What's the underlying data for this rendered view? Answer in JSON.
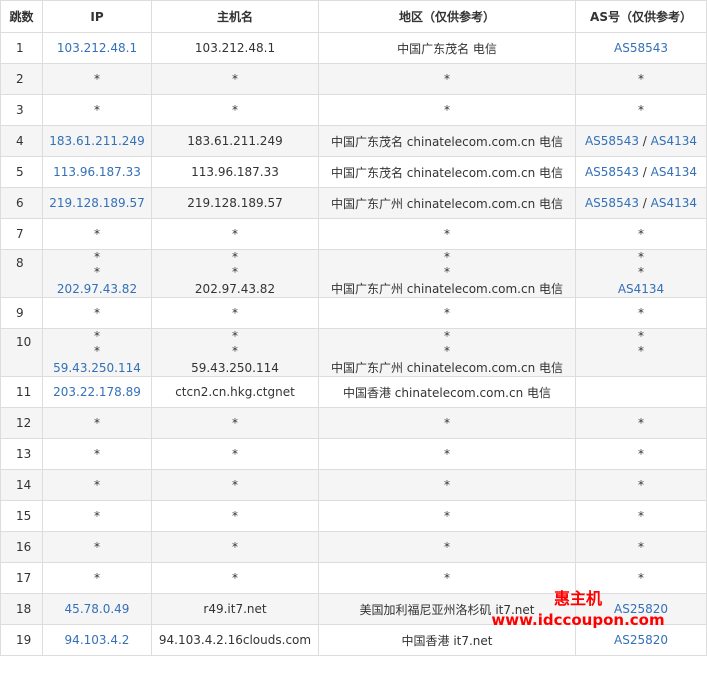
{
  "headers": {
    "hop": "跳数",
    "ip": "IP",
    "host": "主机名",
    "region": "地区（仅供参考）",
    "as": "AS号（仅供参考）"
  },
  "rows": [
    {
      "hop": "1",
      "ip": [
        "103.212.48.1"
      ],
      "host": [
        "103.212.48.1"
      ],
      "region": [
        "中国广东茂名 电信"
      ],
      "as": [
        "AS58543"
      ]
    },
    {
      "hop": "2",
      "ip": [
        "*"
      ],
      "host": [
        "*"
      ],
      "region": [
        "*"
      ],
      "as": [
        "*"
      ]
    },
    {
      "hop": "3",
      "ip": [
        "*"
      ],
      "host": [
        "*"
      ],
      "region": [
        "*"
      ],
      "as": [
        "*"
      ]
    },
    {
      "hop": "4",
      "ip": [
        "183.61.211.249"
      ],
      "host": [
        "183.61.211.249"
      ],
      "region": [
        "中国广东茂名 chinatelecom.com.cn 电信"
      ],
      "as": [
        "AS58543 / AS4134"
      ]
    },
    {
      "hop": "5",
      "ip": [
        "113.96.187.33"
      ],
      "host": [
        "113.96.187.33"
      ],
      "region": [
        "中国广东茂名 chinatelecom.com.cn 电信"
      ],
      "as": [
        "AS58543 / AS4134"
      ]
    },
    {
      "hop": "6",
      "ip": [
        "219.128.189.57"
      ],
      "host": [
        "219.128.189.57"
      ],
      "region": [
        "中国广东广州 chinatelecom.com.cn 电信"
      ],
      "as": [
        "AS58543 / AS4134"
      ]
    },
    {
      "hop": "7",
      "ip": [
        "*"
      ],
      "host": [
        "*"
      ],
      "region": [
        "*"
      ],
      "as": [
        "*"
      ]
    },
    {
      "hop": "8",
      "ip": [
        "*",
        "*",
        "202.97.43.82"
      ],
      "host": [
        "*",
        "*",
        "202.97.43.82"
      ],
      "region": [
        "*",
        "*",
        "中国广东广州 chinatelecom.com.cn 电信"
      ],
      "as": [
        "*",
        "*",
        "AS4134"
      ]
    },
    {
      "hop": "9",
      "ip": [
        "*"
      ],
      "host": [
        "*"
      ],
      "region": [
        "*"
      ],
      "as": [
        "*"
      ]
    },
    {
      "hop": "10",
      "ip": [
        "*",
        "*",
        "59.43.250.114"
      ],
      "host": [
        "*",
        "*",
        "59.43.250.114"
      ],
      "region": [
        "*",
        "*",
        "中国广东广州 chinatelecom.com.cn 电信"
      ],
      "as": [
        "*",
        "*",
        ""
      ]
    },
    {
      "hop": "11",
      "ip": [
        "203.22.178.89"
      ],
      "host": [
        "ctcn2.cn.hkg.ctgnet"
      ],
      "region": [
        "中国香港 chinatelecom.com.cn 电信"
      ],
      "as": [
        ""
      ]
    },
    {
      "hop": "12",
      "ip": [
        "*"
      ],
      "host": [
        "*"
      ],
      "region": [
        "*"
      ],
      "as": [
        "*"
      ]
    },
    {
      "hop": "13",
      "ip": [
        "*"
      ],
      "host": [
        "*"
      ],
      "region": [
        "*"
      ],
      "as": [
        "*"
      ]
    },
    {
      "hop": "14",
      "ip": [
        "*"
      ],
      "host": [
        "*"
      ],
      "region": [
        "*"
      ],
      "as": [
        "*"
      ]
    },
    {
      "hop": "15",
      "ip": [
        "*"
      ],
      "host": [
        "*"
      ],
      "region": [
        "*"
      ],
      "as": [
        "*"
      ]
    },
    {
      "hop": "16",
      "ip": [
        "*"
      ],
      "host": [
        "*"
      ],
      "region": [
        "*"
      ],
      "as": [
        "*"
      ]
    },
    {
      "hop": "17",
      "ip": [
        "*"
      ],
      "host": [
        "*"
      ],
      "region": [
        "*"
      ],
      "as": [
        "*"
      ]
    },
    {
      "hop": "18",
      "ip": [
        "45.78.0.49"
      ],
      "host": [
        "r49.it7.net"
      ],
      "region": [
        "美国加利福尼亚州洛杉矶 it7.net"
      ],
      "as": [
        "AS25820"
      ]
    },
    {
      "hop": "19",
      "ip": [
        "94.103.4.2"
      ],
      "host": [
        "94.103.4.2.16clouds.com"
      ],
      "region": [
        "中国香港 it7.net"
      ],
      "as": [
        "AS25820"
      ]
    }
  ],
  "watermark": {
    "title": "惠主机",
    "url": "www.idccoupon.com"
  },
  "colors": {
    "link": "#3370b7",
    "watermark": "#ff0000",
    "row_alt": "#f5f5f5",
    "border": "#dddddd"
  }
}
